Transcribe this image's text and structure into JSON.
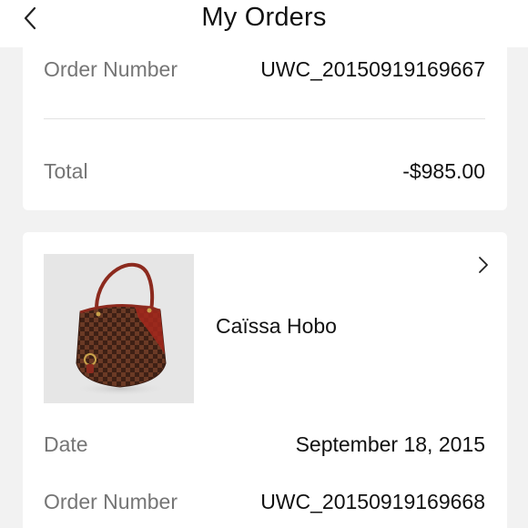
{
  "header": {
    "title": "My Orders",
    "back_icon": "chevron-left-icon"
  },
  "order_1": {
    "order_number_label": "Order Number",
    "order_number": "UWC_20150919169667",
    "total_label": "Total",
    "total": "-$985.00"
  },
  "order_2": {
    "product_name": "Caïssa Hobo",
    "product_image": "handbag-image",
    "detail_icon": "chevron-right-icon",
    "date_label": "Date",
    "date": "September 18, 2015",
    "order_number_label": "Order Number",
    "order_number": "UWC_20150919169668"
  },
  "colors": {
    "background": "#f2f2f2",
    "card": "#ffffff",
    "label": "#757575",
    "text": "#111111",
    "divider": "#e2e2e2"
  }
}
